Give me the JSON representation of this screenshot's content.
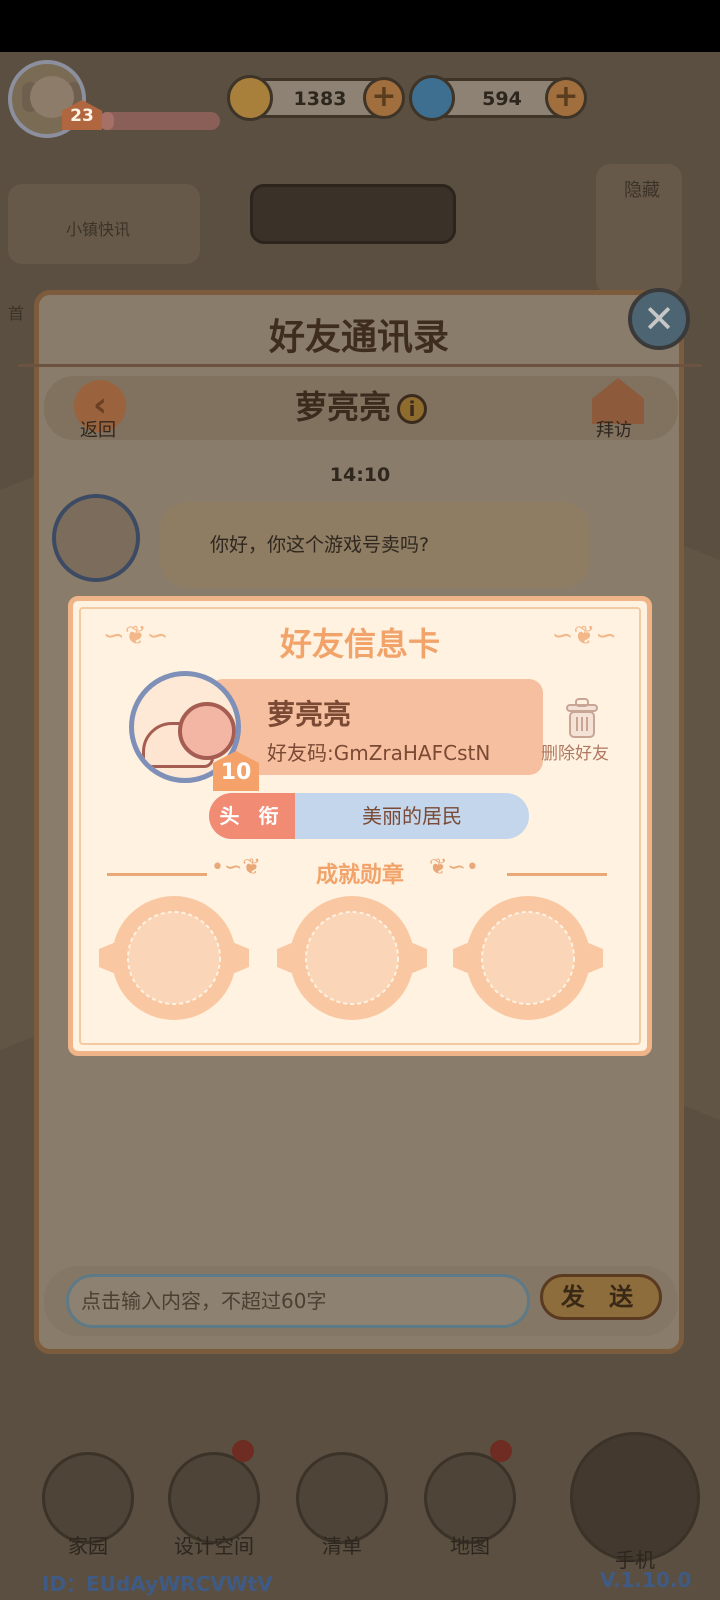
{
  "hud": {
    "level": "23",
    "exp_fraction": 0.12,
    "coins": "1383",
    "gems": "594"
  },
  "background": {
    "news_label": "小镇快讯",
    "hide_label": "隐藏",
    "first_label": "首"
  },
  "contacts": {
    "title": "好友通讯录",
    "back_label": "返回",
    "chat_name": "萝亮亮",
    "info_glyph": "i",
    "visit_label": "拜访",
    "timestamp": "14:10",
    "message": "你好，你这个游戏号卖吗?",
    "input_placeholder": "点击输入内容，不超过60字",
    "send_label": "发 送"
  },
  "info_card": {
    "title": "好友信息卡",
    "name": "萝亮亮",
    "level": "10",
    "friend_code": "好友码:GmZraHAFCstN",
    "delete_label": "删除好友",
    "title_tag": "头 衔",
    "title_value": "美丽的居民",
    "achievements_label": "成就勋章",
    "medal_count": 3
  },
  "close_glyph": "✕",
  "bottom_nav": {
    "items": [
      {
        "label": "家园",
        "has_dot": false
      },
      {
        "label": "设计空间",
        "has_dot": true
      },
      {
        "label": "清单",
        "has_dot": false
      },
      {
        "label": "地图",
        "has_dot": true
      }
    ],
    "phone_label": "手机"
  },
  "footer": {
    "id": "ID：EUdAyWRCVWtV",
    "version": "V.1.10.0"
  },
  "colors": {
    "card_accent": "#f1a36a",
    "card_bg": "#fff2e1",
    "title_tag": "#f18b73",
    "title_value_bg": "#c3d6ec"
  }
}
